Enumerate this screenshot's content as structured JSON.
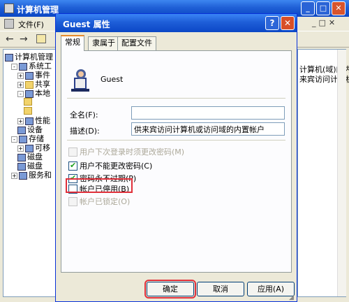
{
  "bg_window": {
    "title": "计算机管理",
    "menu": [
      "文件(F)"
    ],
    "tree": [
      {
        "label": "计算机管理",
        "indent": 0,
        "icon": "computer-icon",
        "expander": ""
      },
      {
        "label": "系统工",
        "indent": 1,
        "icon": "tools-icon",
        "expander": "-"
      },
      {
        "label": "事件",
        "indent": 2,
        "icon": "event-icon",
        "expander": "+"
      },
      {
        "label": "共享",
        "indent": 2,
        "icon": "folder-icon",
        "expander": "+"
      },
      {
        "label": "本地",
        "indent": 2,
        "icon": "users-icon",
        "expander": "-"
      },
      {
        "label": "",
        "indent": 3,
        "icon": "folder-icon",
        "expander": ""
      },
      {
        "label": "",
        "indent": 3,
        "icon": "folder-icon",
        "expander": ""
      },
      {
        "label": "性能",
        "indent": 2,
        "icon": "perf-icon",
        "expander": "+"
      },
      {
        "label": "设备",
        "indent": 2,
        "icon": "device-icon",
        "expander": ""
      },
      {
        "label": "存储",
        "indent": 1,
        "icon": "storage-icon",
        "expander": "-"
      },
      {
        "label": "可移",
        "indent": 2,
        "icon": "drive-icon",
        "expander": "+"
      },
      {
        "label": "磁盘",
        "indent": 2,
        "icon": "disk-icon",
        "expander": ""
      },
      {
        "label": "磁盘",
        "indent": 2,
        "icon": "disk-icon",
        "expander": ""
      },
      {
        "label": "服务和",
        "indent": 1,
        "icon": "services-icon",
        "expander": "+"
      }
    ],
    "right_lines": [
      "计算机(域)的内",
      "来宾访问计算机或"
    ]
  },
  "dialog": {
    "title": "Guest 属性",
    "help_label": "?",
    "close_label": "✕",
    "tabs": [
      "常规",
      "隶属于",
      "配置文件"
    ],
    "active_tab": 0,
    "user_name": "Guest",
    "fullname_label": "全名(F):",
    "fullname_value": "",
    "desc_label": "描述(D):",
    "desc_value": "供来宾访问计算机或访问域的内置帐户",
    "checkboxes": [
      {
        "label": "用户下次登录时须更改密码(M)",
        "checked": false,
        "disabled": true
      },
      {
        "label": "用户不能更改密码(C)",
        "checked": true,
        "disabled": false
      },
      {
        "label": "密码永不过期(P)",
        "checked": true,
        "disabled": false
      },
      {
        "label": "帐户已停用(B)",
        "checked": false,
        "disabled": false
      },
      {
        "label": "帐户已锁定(O)",
        "checked": false,
        "disabled": true
      }
    ],
    "highlight_color": "#e0303a",
    "buttons": {
      "ok": "确定",
      "cancel": "取消",
      "apply": "应用(A)"
    }
  }
}
